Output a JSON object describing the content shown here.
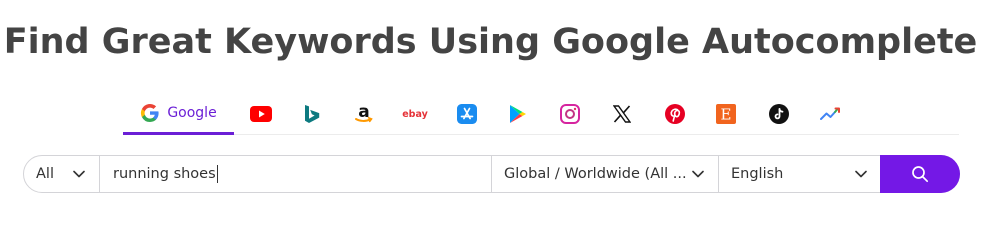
{
  "title": "Find Great Keywords Using Google Autocomplete",
  "tabs": [
    {
      "name": "google",
      "label": "Google",
      "icon": "google-icon",
      "active": true
    },
    {
      "name": "youtube",
      "icon": "youtube-icon"
    },
    {
      "name": "bing",
      "icon": "bing-icon"
    },
    {
      "name": "amazon",
      "icon": "amazon-icon"
    },
    {
      "name": "ebay",
      "icon": "ebay-icon"
    },
    {
      "name": "app-store",
      "icon": "app-store-icon"
    },
    {
      "name": "google-play",
      "icon": "google-play-icon"
    },
    {
      "name": "instagram",
      "icon": "instagram-icon"
    },
    {
      "name": "x",
      "icon": "x-icon"
    },
    {
      "name": "pinterest",
      "icon": "pinterest-icon"
    },
    {
      "name": "etsy",
      "icon": "etsy-icon"
    },
    {
      "name": "tiktok",
      "icon": "tiktok-icon"
    },
    {
      "name": "trends",
      "icon": "trends-icon"
    }
  ],
  "ebay_text": "ebay",
  "amazon_text": "a",
  "etsy_text": "E",
  "search": {
    "type_value": "All",
    "query_value": "running shoes",
    "region_value": "Global / Worldwide (All ...",
    "language_value": "English"
  },
  "colors": {
    "accent": "#6b1fd6",
    "button": "#7418e6"
  }
}
